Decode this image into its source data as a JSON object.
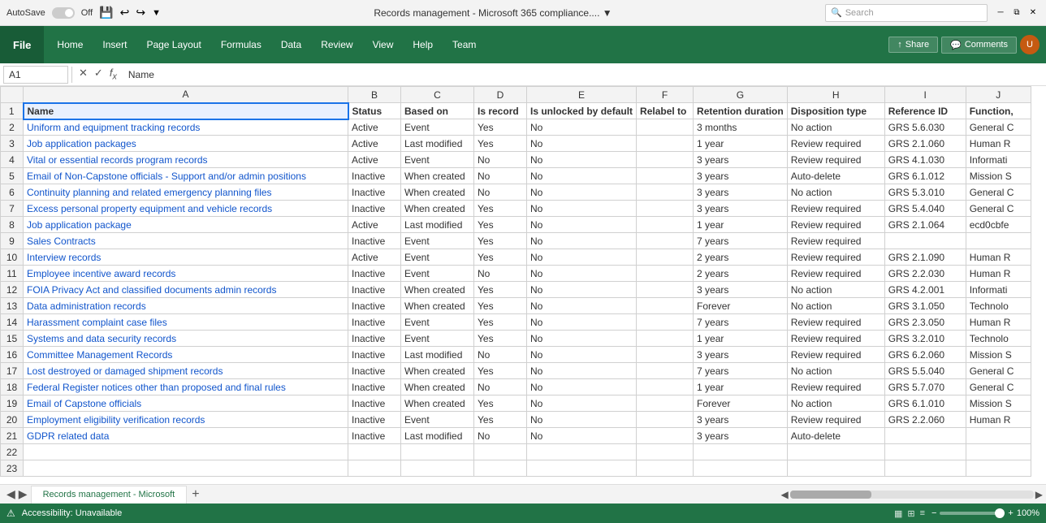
{
  "titleBar": {
    "autosave": "AutoSave",
    "autosaveState": "Off",
    "title": "Records management - Microsoft 365 compliance....  ▼",
    "searchPlaceholder": "Search"
  },
  "ribbon": {
    "fileLabel": "File",
    "tabs": [
      "Home",
      "Insert",
      "Page Layout",
      "Formulas",
      "Data",
      "Review",
      "View",
      "Help",
      "Team"
    ],
    "shareLabel": "Share",
    "commentsLabel": "Comments"
  },
  "formulaBar": {
    "cellRef": "A1",
    "formula": "Name"
  },
  "columns": {
    "headers": [
      "A",
      "B",
      "C",
      "D",
      "E",
      "F",
      "G",
      "H",
      "I",
      "J"
    ]
  },
  "rows": [
    {
      "rowNum": "1",
      "cells": [
        "Name",
        "Status",
        "Based on",
        "Is record",
        "Is unlocked by default",
        "Relabel to",
        "Retention duration",
        "Disposition type",
        "Reference ID",
        "Function,"
      ]
    },
    {
      "rowNum": "2",
      "cells": [
        "Uniform and equipment tracking records",
        "Active",
        "Event",
        "Yes",
        "No",
        "",
        "3 months",
        "No action",
        "GRS 5.6.030",
        "General C"
      ]
    },
    {
      "rowNum": "3",
      "cells": [
        "Job application packages",
        "Active",
        "Last modified",
        "Yes",
        "No",
        "",
        "1 year",
        "Review required",
        "GRS 2.1.060",
        "Human R"
      ]
    },
    {
      "rowNum": "4",
      "cells": [
        "Vital or essential records program records",
        "Active",
        "Event",
        "No",
        "No",
        "",
        "3 years",
        "Review required",
        "GRS 4.1.030",
        "Informati"
      ]
    },
    {
      "rowNum": "5",
      "cells": [
        "Email of Non-Capstone officials - Support and/or admin positions",
        "Inactive",
        "When created",
        "No",
        "No",
        "",
        "3 years",
        "Auto-delete",
        "GRS 6.1.012",
        "Mission S"
      ]
    },
    {
      "rowNum": "6",
      "cells": [
        "Continuity planning and related emergency planning files",
        "Inactive",
        "When created",
        "No",
        "No",
        "",
        "3 years",
        "No action",
        "GRS 5.3.010",
        "General C"
      ]
    },
    {
      "rowNum": "7",
      "cells": [
        "Excess personal property equipment and vehicle records",
        "Inactive",
        "When created",
        "Yes",
        "No",
        "",
        "3 years",
        "Review required",
        "GRS 5.4.040",
        "General C"
      ]
    },
    {
      "rowNum": "8",
      "cells": [
        "Job application package",
        "Active",
        "Last modified",
        "Yes",
        "No",
        "",
        "1 year",
        "Review required",
        "GRS 2.1.064",
        "ecd0cbfe"
      ]
    },
    {
      "rowNum": "9",
      "cells": [
        "Sales Contracts",
        "Inactive",
        "Event",
        "Yes",
        "No",
        "",
        "7 years",
        "Review required",
        "",
        ""
      ]
    },
    {
      "rowNum": "10",
      "cells": [
        "Interview records",
        "Active",
        "Event",
        "Yes",
        "No",
        "",
        "2 years",
        "Review required",
        "GRS 2.1.090",
        "Human R"
      ]
    },
    {
      "rowNum": "11",
      "cells": [
        "Employee incentive award records",
        "Inactive",
        "Event",
        "No",
        "No",
        "",
        "2 years",
        "Review required",
        "GRS 2.2.030",
        "Human R"
      ]
    },
    {
      "rowNum": "12",
      "cells": [
        "FOIA Privacy Act and classified documents admin records",
        "Inactive",
        "When created",
        "Yes",
        "No",
        "",
        "3 years",
        "No action",
        "GRS 4.2.001",
        "Informati"
      ]
    },
    {
      "rowNum": "13",
      "cells": [
        "Data administration records",
        "Inactive",
        "When created",
        "Yes",
        "No",
        "",
        "Forever",
        "No action",
        "GRS 3.1.050",
        "Technolo"
      ]
    },
    {
      "rowNum": "14",
      "cells": [
        "Harassment complaint case files",
        "Inactive",
        "Event",
        "Yes",
        "No",
        "",
        "7 years",
        "Review required",
        "GRS 2.3.050",
        "Human R"
      ]
    },
    {
      "rowNum": "15",
      "cells": [
        "Systems and data security records",
        "Inactive",
        "Event",
        "Yes",
        "No",
        "",
        "1 year",
        "Review required",
        "GRS 3.2.010",
        "Technolo"
      ]
    },
    {
      "rowNum": "16",
      "cells": [
        "Committee Management Records",
        "Inactive",
        "Last modified",
        "No",
        "No",
        "",
        "3 years",
        "Review required",
        "GRS 6.2.060",
        "Mission S"
      ]
    },
    {
      "rowNum": "17",
      "cells": [
        "Lost destroyed or damaged shipment records",
        "Inactive",
        "When created",
        "Yes",
        "No",
        "",
        "7 years",
        "No action",
        "GRS 5.5.040",
        "General C"
      ]
    },
    {
      "rowNum": "18",
      "cells": [
        "Federal Register notices other than proposed and final rules",
        "Inactive",
        "When created",
        "No",
        "No",
        "",
        "1 year",
        "Review required",
        "GRS 5.7.070",
        "General C"
      ]
    },
    {
      "rowNum": "19",
      "cells": [
        "Email of Capstone officials",
        "Inactive",
        "When created",
        "Yes",
        "No",
        "",
        "Forever",
        "No action",
        "GRS 6.1.010",
        "Mission S"
      ]
    },
    {
      "rowNum": "20",
      "cells": [
        "Employment eligibility verification records",
        "Inactive",
        "Event",
        "Yes",
        "No",
        "",
        "3 years",
        "Review required",
        "GRS 2.2.060",
        "Human R"
      ]
    },
    {
      "rowNum": "21",
      "cells": [
        "GDPR related data",
        "Inactive",
        "Last modified",
        "No",
        "No",
        "",
        "3 years",
        "Auto-delete",
        "",
        ""
      ]
    },
    {
      "rowNum": "22",
      "cells": [
        "",
        "",
        "",
        "",
        "",
        "",
        "",
        "",
        "",
        ""
      ]
    },
    {
      "rowNum": "23",
      "cells": [
        "",
        "",
        "",
        "",
        "",
        "",
        "",
        "",
        "",
        ""
      ]
    }
  ],
  "sheetTab": {
    "label": "Records management - Microsoft"
  },
  "statusBar": {
    "accessibility": "Accessibility: Unavailable"
  },
  "zoom": "100%"
}
